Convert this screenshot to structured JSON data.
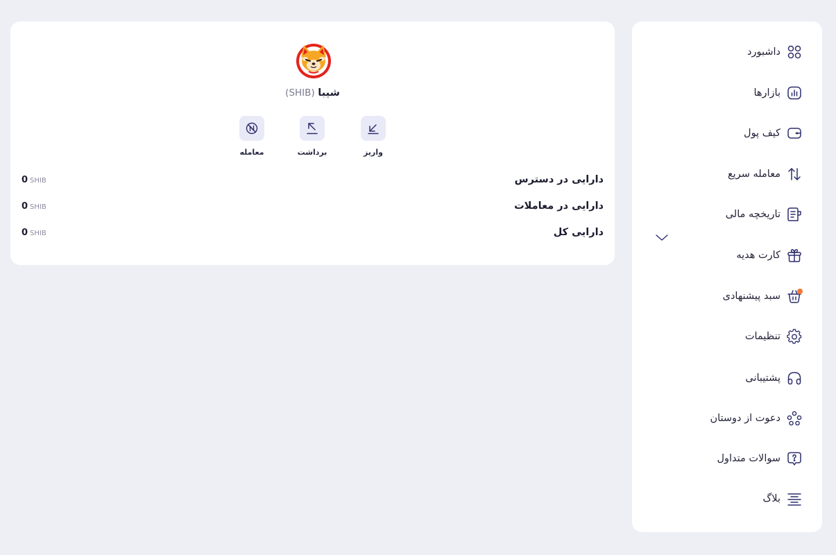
{
  "sidebar": {
    "items": [
      {
        "label": "داشبورد",
        "icon": "dashboard-grid-icon"
      },
      {
        "label": "بازارها",
        "icon": "markets-chart-icon"
      },
      {
        "label": "کیف پول",
        "icon": "wallet-icon"
      },
      {
        "label": "معامله سریع",
        "icon": "swap-arrows-icon"
      },
      {
        "label": "تاریخچه مالی",
        "icon": "receipt-history-icon"
      },
      {
        "label": "کارت هدیه",
        "icon": "gift-icon"
      },
      {
        "label": "سبد پیشنهادی",
        "icon": "basket-icon"
      },
      {
        "label": "تنظیمات",
        "icon": "gear-icon"
      },
      {
        "label": "پشتیبانی",
        "icon": "headphones-icon"
      },
      {
        "label": "دعوت از دوستان",
        "icon": "users-invite-icon"
      },
      {
        "label": "سوالات متداول",
        "icon": "question-chat-icon"
      },
      {
        "label": "بلاگ",
        "icon": "blog-lines-icon"
      }
    ],
    "history_chevron": "chevron-down-icon",
    "basket_notification_color": "#f47a3a"
  },
  "coin": {
    "name": "شیبا",
    "symbol": "(SHIB)",
    "logo": "shiba-inu-logo"
  },
  "actions": {
    "deposit": "واریز",
    "withdraw": "برداشت",
    "trade": "معامله"
  },
  "balances": [
    {
      "label": "دارایی در دسترس",
      "amount": "0",
      "unit": "SHIB"
    },
    {
      "label": "دارایی در معاملات",
      "amount": "0",
      "unit": "SHIB"
    },
    {
      "label": "دارایی کل",
      "amount": "0",
      "unit": "SHIB"
    }
  ],
  "colors": {
    "background": "#eeeff5",
    "card": "#ffffff",
    "action_button_bg": "#e9eaf7",
    "accent": "#2d2f6b"
  }
}
